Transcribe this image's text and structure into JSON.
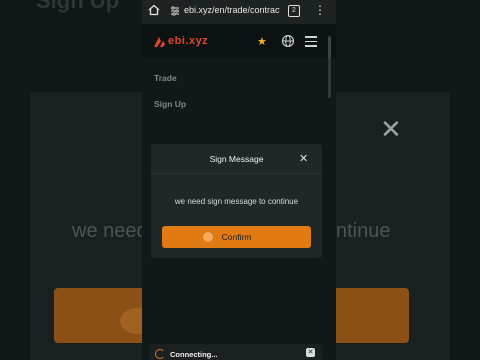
{
  "background": {
    "title": "Sign Up",
    "message_left": "we need",
    "message_right": "ntinue",
    "close_glyph": "✕"
  },
  "browser": {
    "url": "ebi.xyz/en/trade/contract",
    "tab_count": "2",
    "menu_glyph": "⋮"
  },
  "site": {
    "logo_text": "ebi.xyz",
    "brand_color": "#e0452d",
    "star_glyph": "★",
    "nav": [
      {
        "label": "Trade"
      },
      {
        "label": "Sign Up"
      }
    ]
  },
  "modal": {
    "title": "Sign Message",
    "close_glyph": "✕",
    "message": "we need sign message to continue",
    "confirm_label": "Confirm",
    "accent": "#e07b14"
  },
  "toast": {
    "text": "Connecting...",
    "close_glyph": "✕"
  }
}
